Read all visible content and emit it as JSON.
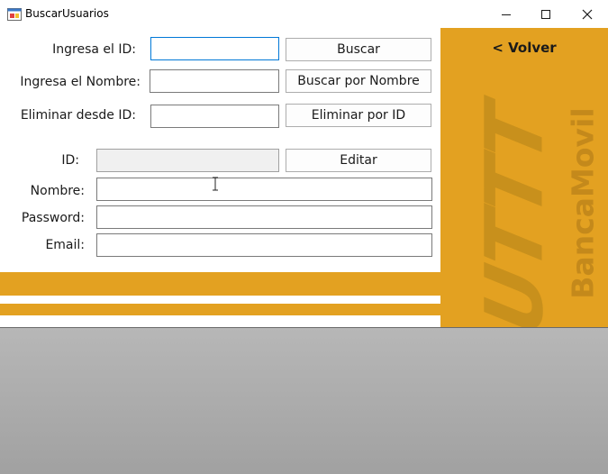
{
  "window": {
    "title": "BuscarUsuarios",
    "controls": {
      "minimize": "—",
      "maximize": "☐",
      "close": "✕"
    }
  },
  "search": {
    "id_label": "Ingresa el ID:",
    "id_value": "",
    "search_button": "Buscar",
    "name_label": "Ingresa el Nombre:",
    "name_value": "",
    "search_name_button": "Buscar por Nombre",
    "delete_label": "Eliminar desde ID:",
    "delete_value": "",
    "delete_button": "Eliminar por ID"
  },
  "details": {
    "id_label": "ID:",
    "id_value": "",
    "edit_button": "Editar",
    "name_label": "Nombre:",
    "name_value": "",
    "password_label": "Password:",
    "password_value": "",
    "email_label": "Email:",
    "email_value": ""
  },
  "side_panel": {
    "back_label": "< Volver",
    "logo_text": "UTTT",
    "brand_text": "BancaMovil"
  },
  "colors": {
    "accent": "#e3a121",
    "background_gray": "#a9a9a9",
    "focus_border": "#0078d7"
  }
}
